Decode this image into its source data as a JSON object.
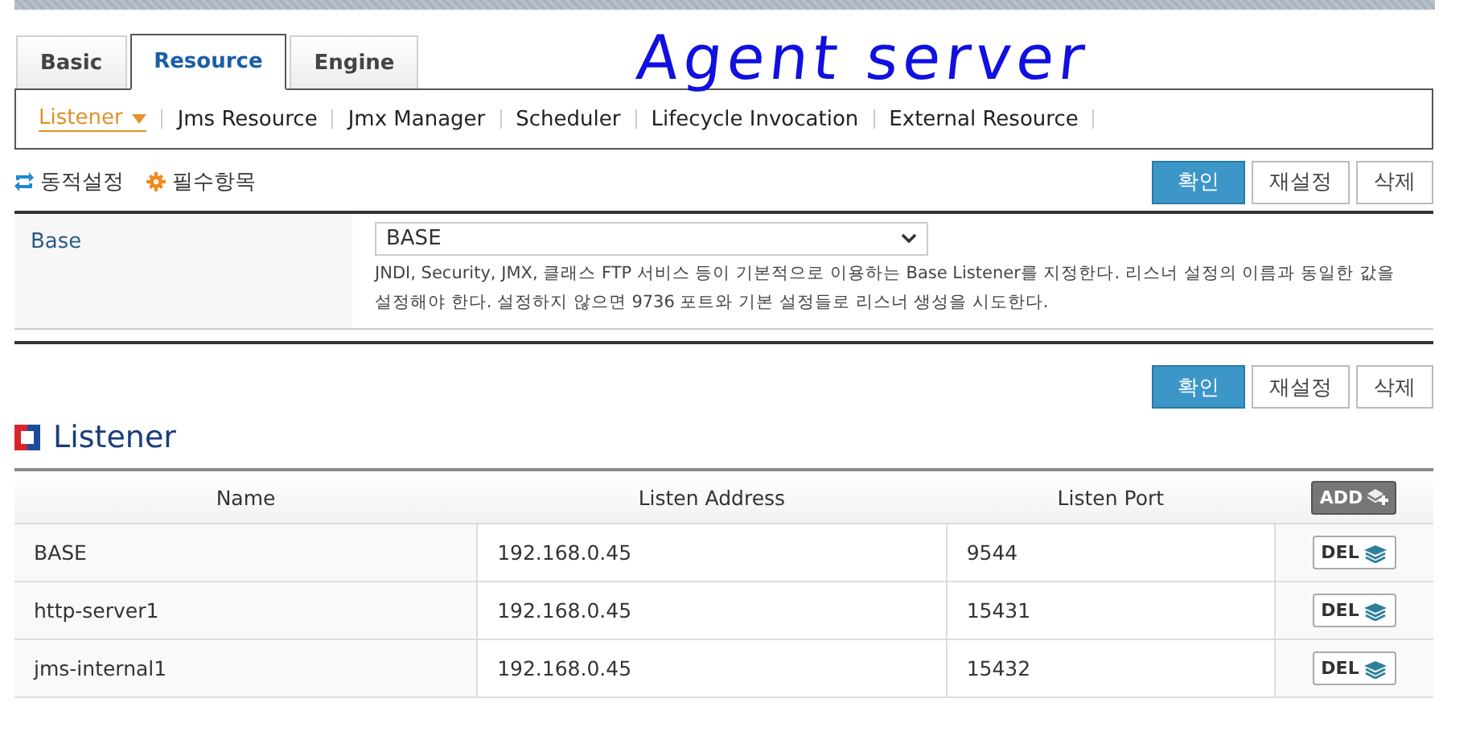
{
  "annotation": "Agent server",
  "tabs": [
    {
      "label": "Basic",
      "selected": false
    },
    {
      "label": "Resource",
      "selected": true
    },
    {
      "label": "Engine",
      "selected": false
    }
  ],
  "submenu": [
    {
      "label": "Listener",
      "selected": true
    },
    {
      "label": "Jms Resource",
      "selected": false
    },
    {
      "label": "Jmx Manager",
      "selected": false
    },
    {
      "label": "Scheduler",
      "selected": false
    },
    {
      "label": "Lifecycle Invocation",
      "selected": false
    },
    {
      "label": "External Resource",
      "selected": false
    }
  ],
  "legend": [
    {
      "kind": "dynamic",
      "label": "동적설정"
    },
    {
      "kind": "required",
      "label": "필수항목"
    }
  ],
  "buttons": [
    {
      "kind": "primary",
      "label": "확인"
    },
    {
      "kind": "normal",
      "label": "재설정"
    },
    {
      "kind": "normal",
      "label": "삭제"
    }
  ],
  "form": {
    "label": "Base",
    "value": "BASE",
    "description": "JNDI, Security, JMX, 클래스 FTP 서비스 등이 기본적으로 이용하는 Base Listener를 지정한다. 리스너 설정의 이름과 동일한 값을 설정해야 한다. 설정하지 않으면 9736 포트와 기본 설정들로 리스너 생성을 시도한다."
  },
  "buttons_2": [
    {
      "kind": "primary",
      "label": "확인"
    },
    {
      "kind": "normal",
      "label": "재설정"
    },
    {
      "kind": "normal",
      "label": "삭제"
    }
  ],
  "section_title": "Listener",
  "table": {
    "columns": [
      "Name",
      "Listen Address",
      "Listen Port"
    ],
    "add_button": "ADD",
    "rows": [
      {
        "cells": [
          "BASE",
          "192.168.0.45",
          "9544"
        ],
        "action": "DEL"
      },
      {
        "cells": [
          "http-server1",
          "192.168.0.45",
          "15431"
        ],
        "action": "DEL"
      },
      {
        "cells": [
          "jms-internal1",
          "192.168.0.45",
          "15432"
        ],
        "action": "DEL"
      }
    ]
  }
}
